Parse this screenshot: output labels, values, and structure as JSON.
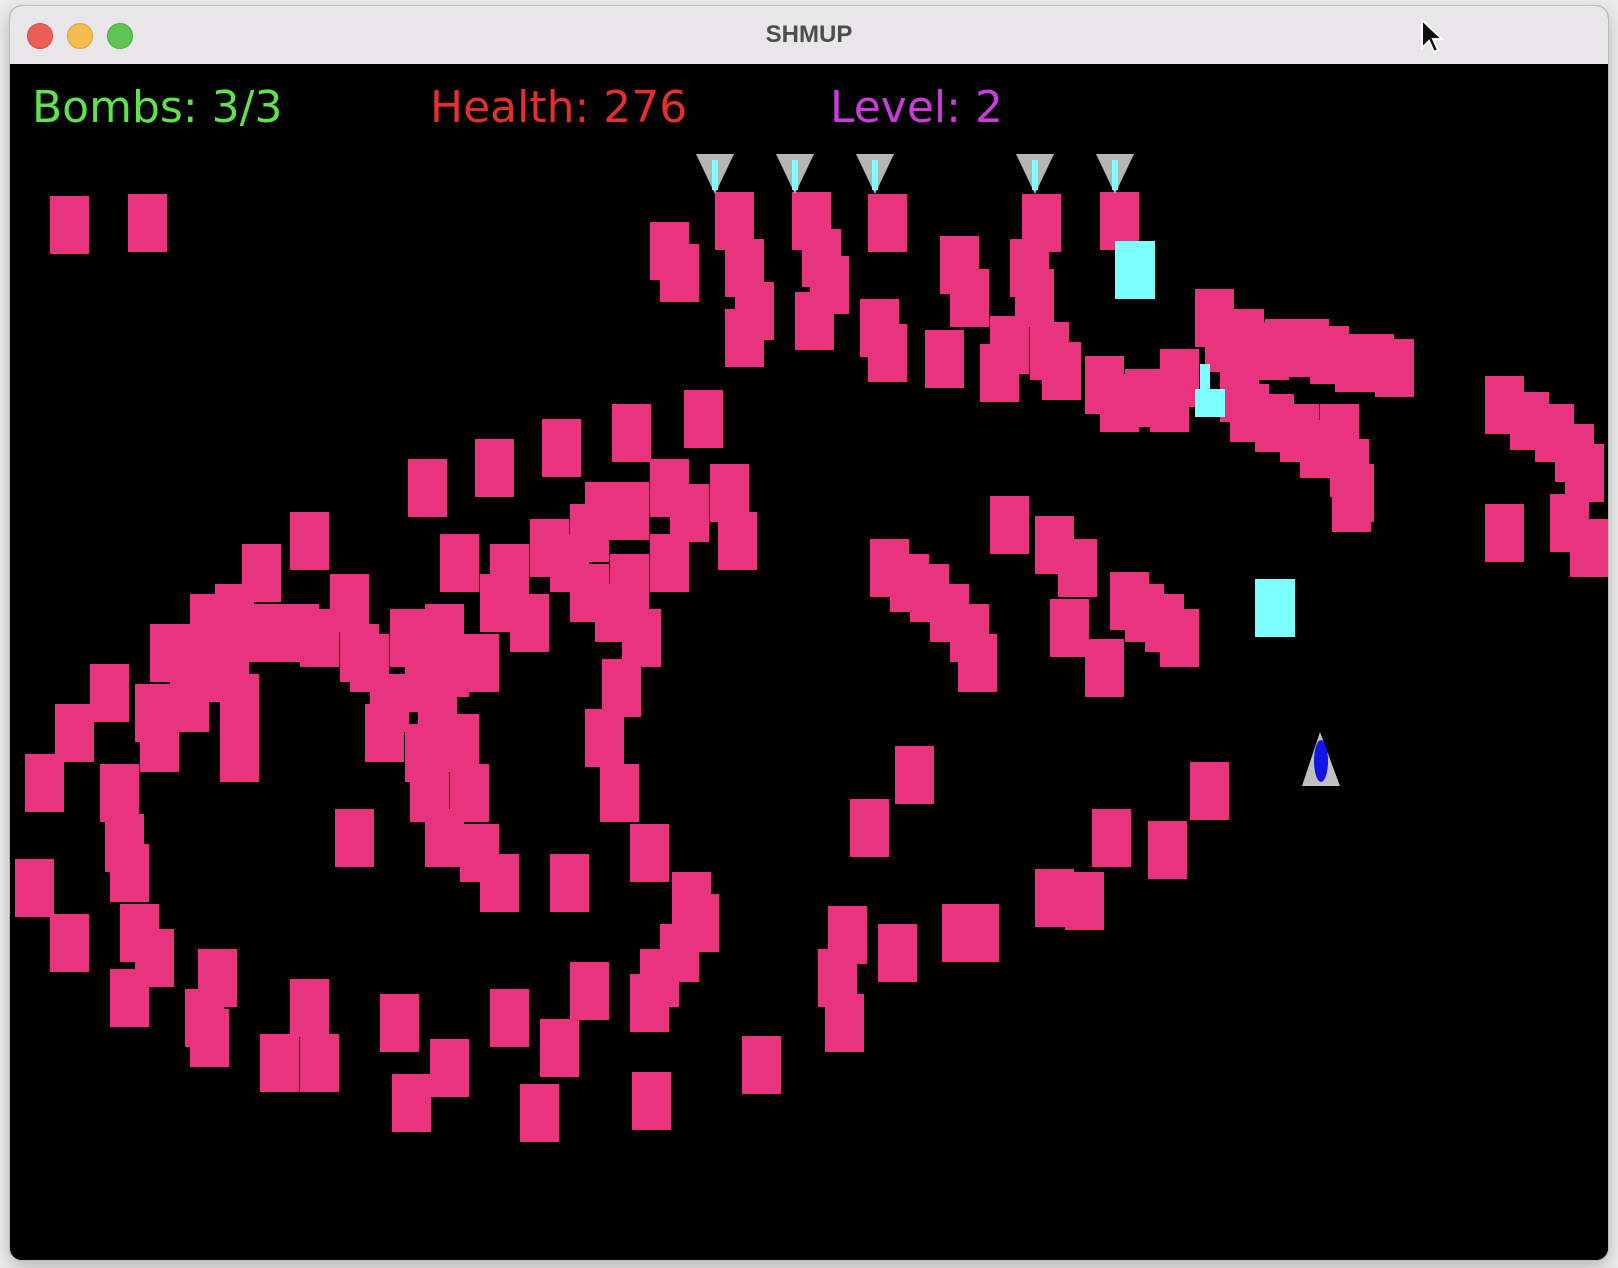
{
  "window": {
    "title": "SHMUP"
  },
  "hud": {
    "bombs": "Bombs: 3/3",
    "health": "Health: 276",
    "level": "Level: 2",
    "colors": {
      "bombs": "#5fe34a",
      "health": "#e2302b",
      "level": "#c93bdb"
    }
  },
  "colors": {
    "background": "#000000",
    "block": "#e8337f",
    "cyan": "#7cffff",
    "ship_body": "#c0c0c0",
    "ship_core": "#1414e6"
  },
  "icons": {
    "player": "player-ship-icon",
    "turret": "enemy-turret-icon",
    "cursor": "mouse-cursor-icon"
  }
}
